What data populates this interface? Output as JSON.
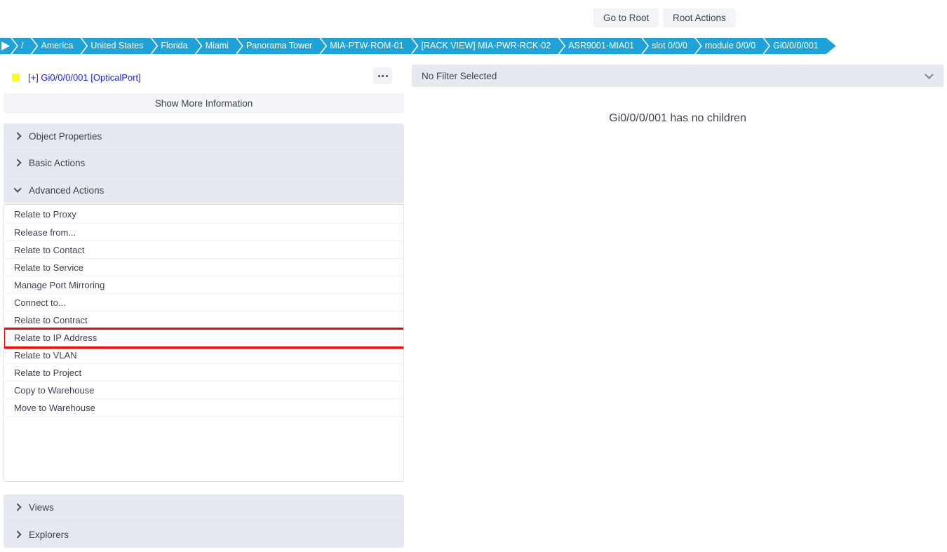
{
  "topbar": {
    "go_to_root_label": "Go to Root",
    "root_actions_label": "Root Actions"
  },
  "breadcrumb": {
    "items": [
      {
        "label": "/"
      },
      {
        "label": "America"
      },
      {
        "label": "United States"
      },
      {
        "label": "Florida"
      },
      {
        "label": "Miami"
      },
      {
        "label": "Panorama Tower"
      },
      {
        "label": "MIA-PTW-ROM-01"
      },
      {
        "label": "[RACK VIEW] MIA-PWR-RCK-02"
      },
      {
        "label": "ASR9001-MIA01"
      },
      {
        "label": "slot 0/0/0"
      },
      {
        "label": "module 0/0/0"
      },
      {
        "label": "Gi0/0/0/001"
      }
    ],
    "accent_color": "#1fa2d8"
  },
  "left_panel": {
    "item": {
      "status_color": "#ffff00",
      "label": "[+] Gi0/0/0/001 [OpticalPort]",
      "label_color": "#2020e0"
    },
    "more_menu_label": "...",
    "show_more_label": "Show More Information",
    "accordions_top": [
      {
        "label": "Object Properties",
        "expanded": false
      },
      {
        "label": "Basic Actions",
        "expanded": false
      },
      {
        "label": "Advanced Actions",
        "expanded": true
      }
    ],
    "advanced_actions": [
      {
        "label": "Relate to Proxy",
        "highlighted": false
      },
      {
        "label": "Release from...",
        "highlighted": false
      },
      {
        "label": "Relate to Contact",
        "highlighted": false
      },
      {
        "label": "Relate to Service",
        "highlighted": false
      },
      {
        "label": "Manage Port Mirroring",
        "highlighted": false
      },
      {
        "label": "Connect to...",
        "highlighted": false
      },
      {
        "label": "Relate to Contract",
        "highlighted": false
      },
      {
        "label": "Relate to IP Address",
        "highlighted": true
      },
      {
        "label": "Relate to VLAN",
        "highlighted": false
      },
      {
        "label": "Relate to Project",
        "highlighted": false
      },
      {
        "label": "Copy to Warehouse",
        "highlighted": false
      },
      {
        "label": "Move to Warehouse",
        "highlighted": false
      }
    ],
    "accordions_bottom": [
      {
        "label": "Views",
        "expanded": false
      },
      {
        "label": "Explorers",
        "expanded": false
      }
    ],
    "highlight_color": "#fc0000"
  },
  "right_panel": {
    "filter_value": "No Filter Selected",
    "empty_message": "Gi0/0/0/001 has no children"
  }
}
